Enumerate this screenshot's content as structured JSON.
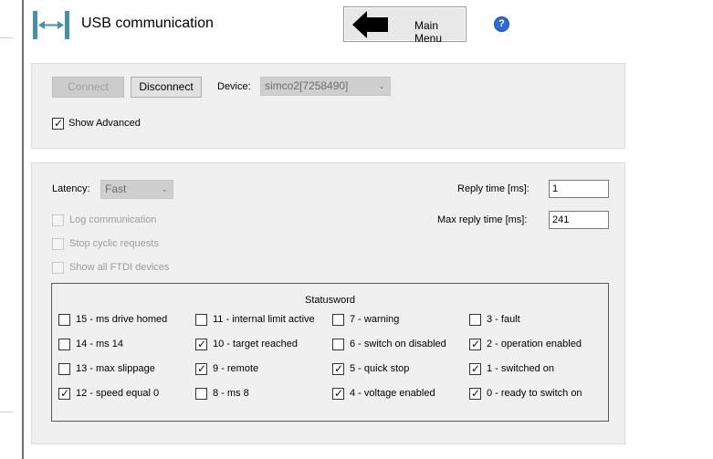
{
  "header": {
    "title": "USB communication",
    "main_menu_label": "Main Menu",
    "help_label": "?"
  },
  "connection": {
    "connect_label": "Connect",
    "disconnect_label": "Disconnect",
    "device_label": "Device:",
    "device_value": "simco2[7258490]",
    "show_advanced_label": "Show Advanced",
    "show_advanced_checked": true
  },
  "advanced": {
    "latency_label": "Latency:",
    "latency_value": "Fast",
    "reply_time_label": "Reply time [ms]:",
    "reply_time_value": "1",
    "max_reply_time_label": "Max reply time [ms]:",
    "max_reply_time_value": "241",
    "options": [
      {
        "label": "Log communication",
        "checked": false
      },
      {
        "label": "Stop cyclic requests",
        "checked": false
      },
      {
        "label": "Show all FTDI devices",
        "checked": false
      }
    ]
  },
  "statusword": {
    "title": "Statusword",
    "bits": [
      {
        "label": "15 - ms drive homed",
        "checked": false
      },
      {
        "label": "11 - internal limit active",
        "checked": false
      },
      {
        "label": "7 - warning",
        "checked": false
      },
      {
        "label": "3 - fault",
        "checked": false
      },
      {
        "label": "14 - ms 14",
        "checked": false
      },
      {
        "label": "10 - target reached",
        "checked": true
      },
      {
        "label": "6 - switch on disabled",
        "checked": false
      },
      {
        "label": "2 - operation enabled",
        "checked": true
      },
      {
        "label": "13 - max slippage",
        "checked": false
      },
      {
        "label": "9 - remote",
        "checked": true
      },
      {
        "label": "5 - quick stop",
        "checked": true
      },
      {
        "label": "1 - switched on",
        "checked": true
      },
      {
        "label": "12 - speed equal 0",
        "checked": true
      },
      {
        "label": "8 - ms 8",
        "checked": false
      },
      {
        "label": "4 - voltage enabled",
        "checked": true
      },
      {
        "label": "0 - ready to switch on",
        "checked": true
      }
    ]
  },
  "colors": {
    "panel_bg": "#f0f0f0",
    "icon_color": "#4a8fa8",
    "help_blue": "#2f6bcf",
    "divider": "#6e6e6e"
  }
}
